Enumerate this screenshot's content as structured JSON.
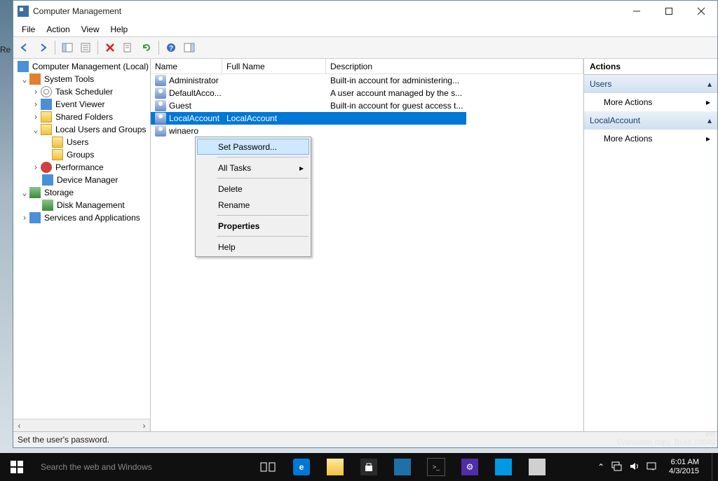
{
  "window": {
    "title": "Computer Management",
    "min": "—",
    "max": "☐",
    "close": "✕"
  },
  "menu": [
    "File",
    "Action",
    "View",
    "Help"
  ],
  "tree": {
    "root": "Computer Management (Local)",
    "system_tools": "System Tools",
    "task_scheduler": "Task Scheduler",
    "event_viewer": "Event Viewer",
    "shared_folders": "Shared Folders",
    "local_users": "Local Users and Groups",
    "users": "Users",
    "groups": "Groups",
    "performance": "Performance",
    "device_manager": "Device Manager",
    "storage": "Storage",
    "disk_management": "Disk Management",
    "services_apps": "Services and Applications"
  },
  "list": {
    "cols": {
      "name": "Name",
      "full": "Full Name",
      "desc": "Description"
    },
    "rows": [
      {
        "name": "Administrator",
        "full": "",
        "desc": "Built-in account for administering..."
      },
      {
        "name": "DefaultAcco...",
        "full": "",
        "desc": "A user account managed by the s..."
      },
      {
        "name": "Guest",
        "full": "",
        "desc": "Built-in account for guest access t..."
      },
      {
        "name": "LocalAccount",
        "full": "LocalAccount",
        "desc": ""
      },
      {
        "name": "winaero",
        "full": "",
        "desc": ""
      }
    ],
    "selected_index": 3
  },
  "context_menu": {
    "set_password": "Set Password...",
    "all_tasks": "All Tasks",
    "delete": "Delete",
    "rename": "Rename",
    "properties": "Properties",
    "help": "Help"
  },
  "actions": {
    "title": "Actions",
    "group1": "Users",
    "group2": "LocalAccount",
    "more": "More Actions"
  },
  "status": "Set the user's password.",
  "left_sliver": "Re",
  "ghost1": "ew",
  "ghost2": "Evaluation copy. Build 10049",
  "taskbar": {
    "search_placeholder": "Search the web and Windows",
    "time": "6:01 AM",
    "date": "4/3/2015"
  }
}
